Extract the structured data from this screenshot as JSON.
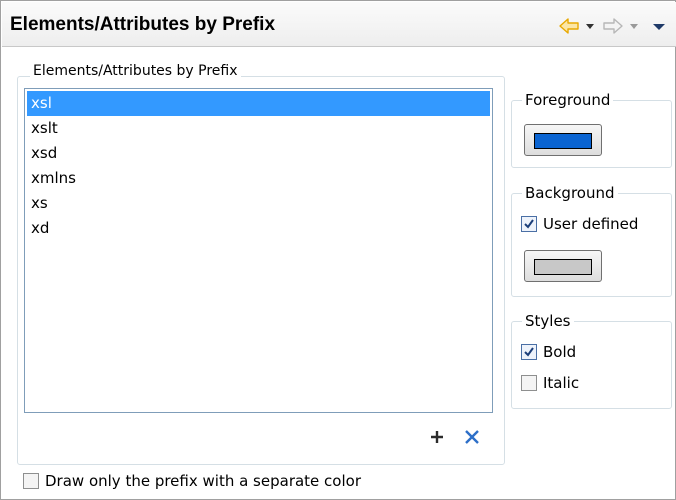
{
  "header": {
    "title": "Elements/Attributes by Prefix"
  },
  "prefix_group": {
    "label": "Elements/Attributes by Prefix",
    "items": [
      "xsl",
      "xslt",
      "xsd",
      "xmlns",
      "xs",
      "xd"
    ],
    "selected_index": 0
  },
  "foreground": {
    "label": "Foreground",
    "color": "#0a64d2"
  },
  "background": {
    "label": "Background",
    "user_defined_label": "User defined",
    "user_defined_checked": true,
    "color": "#c8c8c8"
  },
  "styles": {
    "label": "Styles",
    "bold_label": "Bold",
    "bold_checked": true,
    "italic_label": "Italic",
    "italic_checked": false
  },
  "footer": {
    "separate_color_label": "Draw only the prefix with a separate color",
    "separate_color_checked": false
  },
  "colors": {
    "accent": "#3399ff",
    "nav_arrow": "#f2b821",
    "delete": "#2d6fc8"
  }
}
